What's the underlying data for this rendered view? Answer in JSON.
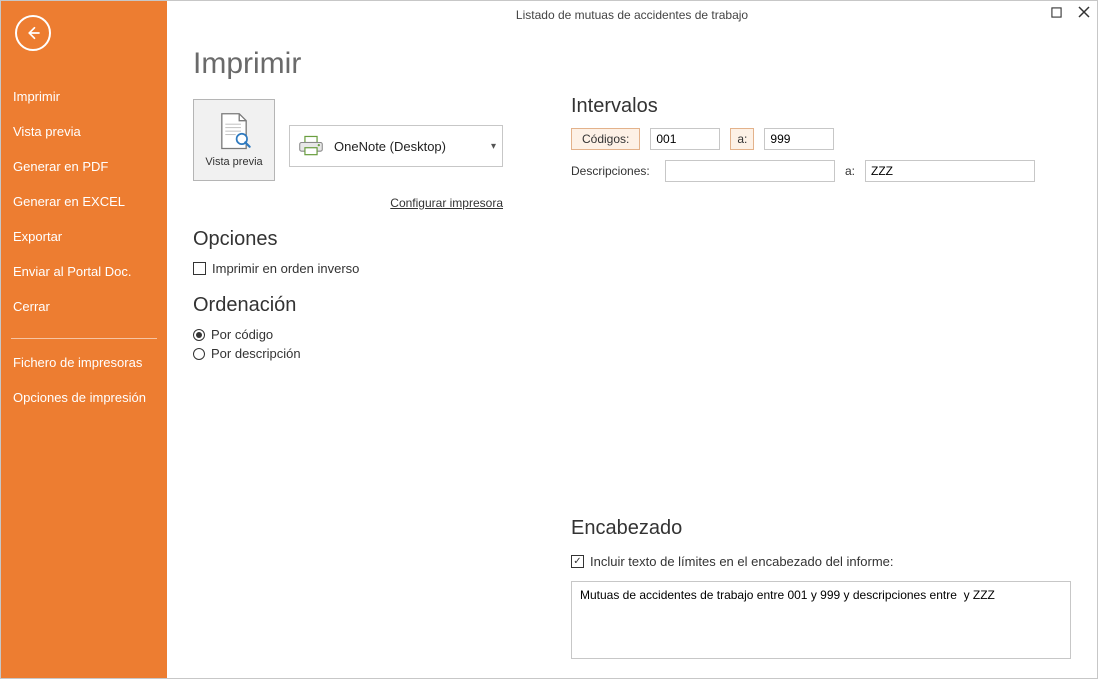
{
  "window": {
    "title": "Listado de mutuas de accidentes de trabajo"
  },
  "sidebar": {
    "items": [
      {
        "label": "Imprimir"
      },
      {
        "label": "Vista previa"
      },
      {
        "label": "Generar en PDF"
      },
      {
        "label": "Generar en EXCEL"
      },
      {
        "label": "Exportar"
      },
      {
        "label": "Enviar al Portal Doc."
      },
      {
        "label": "Cerrar"
      }
    ],
    "items2": [
      {
        "label": "Fichero de impresoras"
      },
      {
        "label": "Opciones de impresión"
      }
    ]
  },
  "main": {
    "title": "Imprimir",
    "preview_label": "Vista previa",
    "printer": "OneNote (Desktop)",
    "config_link": "Configurar impresora",
    "opciones_heading": "Opciones",
    "reverse_label": "Imprimir en orden inverso",
    "reverse_checked": false,
    "orden_heading": "Ordenación",
    "orden": {
      "por_codigo": "Por código",
      "por_descripcion": "Por descripción",
      "selected": "codigo"
    }
  },
  "intervalos": {
    "heading": "Intervalos",
    "codigos_label": "Códigos:",
    "codigos_from": "001",
    "a_label": "a:",
    "codigos_to": "999",
    "desc_label": "Descripciones:",
    "desc_from": "",
    "desc_to": "ZZZ"
  },
  "encabezado": {
    "heading": "Encabezado",
    "include_label": "Incluir texto de límites en el encabezado del informe:",
    "include_checked": true,
    "text": "Mutuas de accidentes de trabajo entre 001 y 999 y descripciones entre  y ZZZ"
  }
}
